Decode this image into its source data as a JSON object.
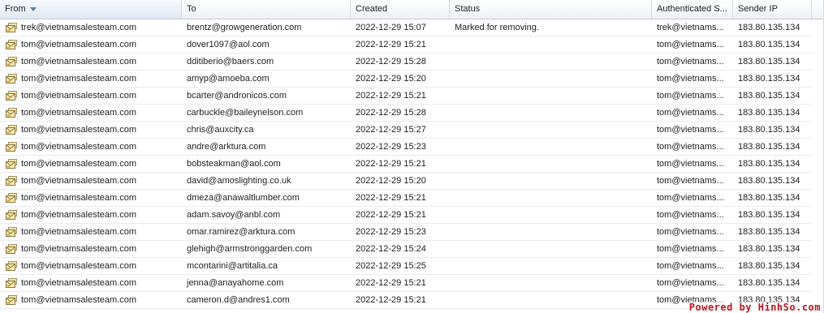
{
  "columns": [
    {
      "label": "From",
      "sorted": true
    },
    {
      "label": "To"
    },
    {
      "label": "Created"
    },
    {
      "label": "Status"
    },
    {
      "label": "Authenticated S..."
    },
    {
      "label": "Sender IP"
    }
  ],
  "rows": [
    {
      "from": "trek@vietnamsalesteam.com",
      "to": "brentz@growgeneration.com",
      "created": "2022-12-29 15:07",
      "status": "Marked for removing.",
      "auth": "trek@vietnams...",
      "ip": "183.80.135.134"
    },
    {
      "from": "tom@vietnamsalesteam.com",
      "to": "dover1097@aol.com",
      "created": "2022-12-29 15:21",
      "status": "",
      "auth": "tom@vietnams...",
      "ip": "183.80.135.134"
    },
    {
      "from": "tom@vietnamsalesteam.com",
      "to": "dditiberio@baers.com",
      "created": "2022-12-29 15:28",
      "status": "",
      "auth": "tom@vietnams...",
      "ip": "183.80.135.134"
    },
    {
      "from": "tom@vietnamsalesteam.com",
      "to": "amyp@amoeba.com",
      "created": "2022-12-29 15:20",
      "status": "",
      "auth": "tom@vietnams...",
      "ip": "183.80.135.134"
    },
    {
      "from": "tom@vietnamsalesteam.com",
      "to": "bcarter@andronicos.com",
      "created": "2022-12-29 15:21",
      "status": "",
      "auth": "tom@vietnams...",
      "ip": "183.80.135.134"
    },
    {
      "from": "tom@vietnamsalesteam.com",
      "to": "carbuckle@baileynelson.com",
      "created": "2022-12-29 15:28",
      "status": "",
      "auth": "tom@vietnams...",
      "ip": "183.80.135.134"
    },
    {
      "from": "tom@vietnamsalesteam.com",
      "to": "chris@auxcity.ca",
      "created": "2022-12-29 15:27",
      "status": "",
      "auth": "tom@vietnams...",
      "ip": "183.80.135.134"
    },
    {
      "from": "tom@vietnamsalesteam.com",
      "to": "andre@arktura.com",
      "created": "2022-12-29 15:23",
      "status": "",
      "auth": "tom@vietnams...",
      "ip": "183.80.135.134"
    },
    {
      "from": "tom@vietnamsalesteam.com",
      "to": "bobsteakman@aol.com",
      "created": "2022-12-29 15:21",
      "status": "",
      "auth": "tom@vietnams...",
      "ip": "183.80.135.134"
    },
    {
      "from": "tom@vietnamsalesteam.com",
      "to": "david@amoslighting.co.uk",
      "created": "2022-12-29 15:20",
      "status": "",
      "auth": "tom@vietnams...",
      "ip": "183.80.135.134"
    },
    {
      "from": "tom@vietnamsalesteam.com",
      "to": "dmeza@anawaltlumber.com",
      "created": "2022-12-29 15:21",
      "status": "",
      "auth": "tom@vietnams...",
      "ip": "183.80.135.134"
    },
    {
      "from": "tom@vietnamsalesteam.com",
      "to": "adam.savoy@anbl.com",
      "created": "2022-12-29 15:21",
      "status": "",
      "auth": "tom@vietnams...",
      "ip": "183.80.135.134"
    },
    {
      "from": "tom@vietnamsalesteam.com",
      "to": "omar.ramirez@arktura.com",
      "created": "2022-12-29 15:23",
      "status": "",
      "auth": "tom@vietnams...",
      "ip": "183.80.135.134"
    },
    {
      "from": "tom@vietnamsalesteam.com",
      "to": "glehigh@armstronggarden.com",
      "created": "2022-12-29 15:24",
      "status": "",
      "auth": "tom@vietnams...",
      "ip": "183.80.135.134"
    },
    {
      "from": "tom@vietnamsalesteam.com",
      "to": "mcontarini@artitalia.ca",
      "created": "2022-12-29 15:25",
      "status": "",
      "auth": "tom@vietnams...",
      "ip": "183.80.135.134"
    },
    {
      "from": "tom@vietnamsalesteam.com",
      "to": "jenna@anayahome.com",
      "created": "2022-12-29 15:21",
      "status": "",
      "auth": "tom@vietnams...",
      "ip": "183.80.135.134"
    },
    {
      "from": "tom@vietnamsalesteam.com",
      "to": "cameron.d@andres1.com",
      "created": "2022-12-29 15:21",
      "status": "",
      "auth": "tom@vietnams...",
      "ip": "183.80.135.134"
    }
  ],
  "icons": {
    "row_icon": "envelope-queue-icon",
    "sort_icon": "sort-descending-icon"
  },
  "colors": {
    "accent": "#5a7fae",
    "watermark": "#c0141b"
  },
  "watermark": "Powered by HinhSo.com"
}
